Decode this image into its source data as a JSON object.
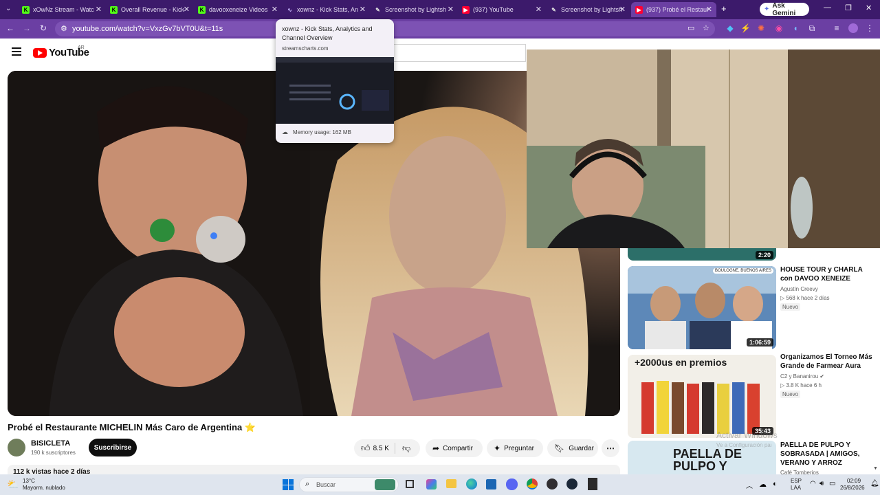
{
  "browser": {
    "tabs": [
      {
        "label": "xOwNz Stream - Watc",
        "favicon": "kick-icon"
      },
      {
        "label": "Overall Revenue - Kick",
        "favicon": "kick-icon"
      },
      {
        "label": "davooxeneize Videos",
        "favicon": "kick-icon"
      },
      {
        "label": "xownz - Kick Stats, An",
        "favicon": "streamscharts-icon"
      },
      {
        "label": "Screenshot by Lightsh",
        "favicon": "pen-icon"
      },
      {
        "label": "(937) YouTube",
        "favicon": "youtube-icon"
      },
      {
        "label": "Screenshot by Lightsh",
        "favicon": "pen-icon"
      },
      {
        "label": "(937) Probé el Restaur",
        "favicon": "youtube-icon"
      }
    ],
    "new_tab": "+",
    "ask_gemini": "Ask Gemini",
    "url": "youtube.com/watch?v=VxzGv7bVT0U&t=11s",
    "tooltip": {
      "title": "xownz - Kick Stats, Analytics and Channel Overview",
      "domain": "streamscharts.com",
      "memory": "Memory usage: 162 MB"
    }
  },
  "youtube": {
    "logo_text": "YouTube",
    "country": "AR",
    "video_title": "Probé el Restaurante MICHELIN Más Caro de Argentina ⭐",
    "channel_name": "BISICLETA",
    "subscribers": "190 k suscriptores",
    "subscribe_label": "Suscribirse",
    "likes": "8.5 K",
    "share_label": "Compartir",
    "ask_label": "Preguntar",
    "save_label": "Guardar",
    "views_partial": "112 k vistas  hace 2 días"
  },
  "sidebar": [
    {
      "duration": "2:20"
    },
    {
      "title": "HOUSE TOUR y CHARLA con DAVOO XENEIZE",
      "channel": "Agustín Creevy",
      "meta": "568 k   hace 2 días",
      "badge": "Nuevo",
      "duration": "1:06:59",
      "thumb_tag": "BOULOGNE, BUENOS AIRES"
    },
    {
      "title": "Organizamos El Torneo Más Grande de Farmear Aura",
      "channel": "C2  y Bananirou",
      "meta": "3.8 K   hace 6 h",
      "badge": "Nuevo",
      "duration": "35:43",
      "thumb_text": "+2000us en premios"
    },
    {
      "title": "PAELLA DE PULPO Y SOBRASADA | AMIGOS, VERANO Y ARROZ",
      "channel": "Café Tomberios",
      "thumb_text": "PAELLA DE PULPO Y"
    }
  ],
  "watermark": {
    "line1": "Activar Windows",
    "line2": "Ve a Configuración para activar Windows."
  },
  "taskbar": {
    "weather_temp": "13°C",
    "weather_desc": "Mayorm. nublado",
    "search_placeholder": "Buscar",
    "lang1": "ESP",
    "lang2": "LAA",
    "time": "02:09",
    "date": "26/8/2026"
  },
  "colors": {
    "tabstrip": "#3c1a6b",
    "toolbar": "#6b3fa3",
    "youtube_red": "#ff0000"
  }
}
